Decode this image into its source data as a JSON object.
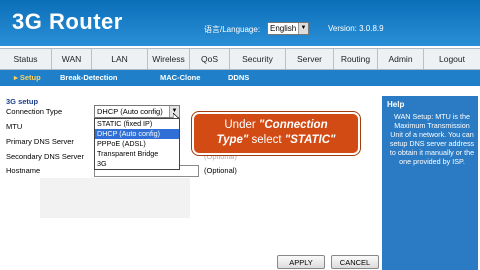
{
  "header": {
    "logo": "3G Router",
    "language_label": "语言/Language:",
    "language_value": "English",
    "version": "Version: 3.0.8.9"
  },
  "nav": {
    "items": [
      "Status",
      "WAN",
      "LAN",
      "Wireless",
      "QoS",
      "Security",
      "Server",
      "Routing",
      "Admin",
      "Logout"
    ]
  },
  "subnav": {
    "items": [
      "Setup",
      "Break-Detection",
      "MAC-Clone",
      "DDNS"
    ],
    "active": "Setup"
  },
  "form": {
    "section_title": "3G setup",
    "connection_type_label": "Connection Type",
    "connection_type_value": "DHCP (Auto config)",
    "mtu_label": "MTU",
    "primary_dns_label": "Primary DNS Server",
    "secondary_dns_label": "Secondary DNS Server",
    "hostname_label": "Hostname",
    "optional_text": "(Optional)",
    "optional_faded_text": "(Optional)",
    "dropdown_options": [
      "STATIC (fixed IP)",
      "DHCP (Auto config)",
      "PPPoE (ADSL)",
      "Transparent Bridge",
      "3G"
    ],
    "dropdown_selected_index": 1
  },
  "callout": {
    "line1_prefix": "Under ",
    "line1_emph": "\"Connection",
    "line2_emph": "Type\"",
    "line2_mid": " select ",
    "line2_value": "\"STATIC\""
  },
  "help": {
    "title": "Help",
    "text": "WAN Setup: MTU is the Maximum Transmission Unit of a network. You can setup DNS server address to obtain it manually or the one provided by ISP."
  },
  "buttons": {
    "apply": "APPLY",
    "cancel": "CANCEL"
  },
  "colors": {
    "header_blue": "#1a7ecb",
    "subnav_blue": "#1f7fc9",
    "help_blue": "#2b7bc4",
    "callout_orange": "#d24a14",
    "selected_option": "#2f6fd6"
  }
}
